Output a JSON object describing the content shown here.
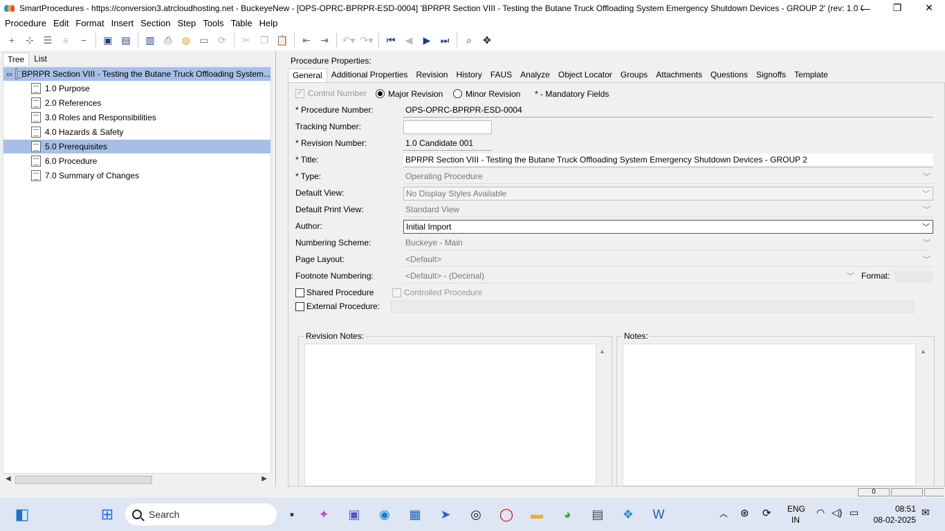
{
  "window": {
    "title": "SmartProcedures - https://conversion3.atrcloudhosting.net - BuckeyeNew - [OPS-OPRC-BPRPR-ESD-0004] 'BPRPR Section VIII - Testing the Butane Truck Offloading System Emergency Shutdown Devices - GROUP 2' (rev: 1.0 Ca...",
    "minimize": "—",
    "restore": "❐",
    "close": "✕"
  },
  "menu": [
    "Procedure",
    "Edit",
    "Format",
    "Insert",
    "Section",
    "Step",
    "Tools",
    "Table",
    "Help"
  ],
  "left": {
    "tabs": [
      "Tree",
      "List"
    ],
    "tree": [
      {
        "label": "BPRPR Section VIII - Testing the Butane Truck Offloading System..."
      },
      {
        "label": "1.0 Purpose"
      },
      {
        "label": "2.0 References"
      },
      {
        "label": "3.0 Roles and Responsibilities"
      },
      {
        "label": "4.0 Hazards & Safety"
      },
      {
        "label": "5.0 Prerequisites"
      },
      {
        "label": "6.0 Procedure"
      },
      {
        "label": "7.0 Summary of Changes"
      }
    ]
  },
  "right": {
    "title": "Procedure Properties:",
    "tabs": [
      "General",
      "Additional Properties",
      "Revision",
      "History",
      "FAUS",
      "Analyze",
      "Object Locator",
      "Groups",
      "Attachments",
      "Questions",
      "Signoffs",
      "Template"
    ],
    "control_number": "Control Number",
    "major_revision": "Major Revision",
    "minor_revision": "Minor Revision",
    "mandatory": "* - Mandatory Fields",
    "labels": {
      "procedure_number": "* Procedure Number:",
      "tracking_number": "Tracking Number:",
      "revision_number": "* Revision Number:",
      "title": "* Title:",
      "type": "* Type:",
      "default_view": "Default View:",
      "default_print_view": "Default Print View:",
      "author": "Author:",
      "numbering_scheme": "Numbering Scheme:",
      "page_layout": "Page Layout:",
      "footnote_numbering": "Footnote Numbering:",
      "format": "Format:",
      "shared_procedure": "Shared Procedure",
      "controlled_procedure": "Controlled Procedure",
      "external_procedure": "External Procedure:",
      "revision_notes": "Revision Notes:",
      "notes": "Notes:"
    },
    "values": {
      "procedure_number": "OPS-OPRC-BPRPR-ESD-0004",
      "tracking_number": "",
      "revision_number": "1.0 Candidate 001",
      "title": "BPRPR Section VIII - Testing the Butane Truck Offloading System Emergency Shutdown Devices - GROUP 2",
      "type": "Operating Procedure",
      "default_view": "No Display Styles Available",
      "default_print_view": "Standard View",
      "author": "Initial Import",
      "numbering_scheme": "Buckeye - Main",
      "page_layout": "<Default>",
      "footnote_numbering": "<Default> - (Decimal)"
    }
  },
  "statusbar": {
    "cell1": "0"
  },
  "taskbar": {
    "search": "Search",
    "lang": "ENG",
    "region": "IN",
    "time": "08:51",
    "date": "08-02-2025"
  },
  "colors": {
    "selection": "#a7bfe8",
    "taskbar": "#dde6f2"
  }
}
